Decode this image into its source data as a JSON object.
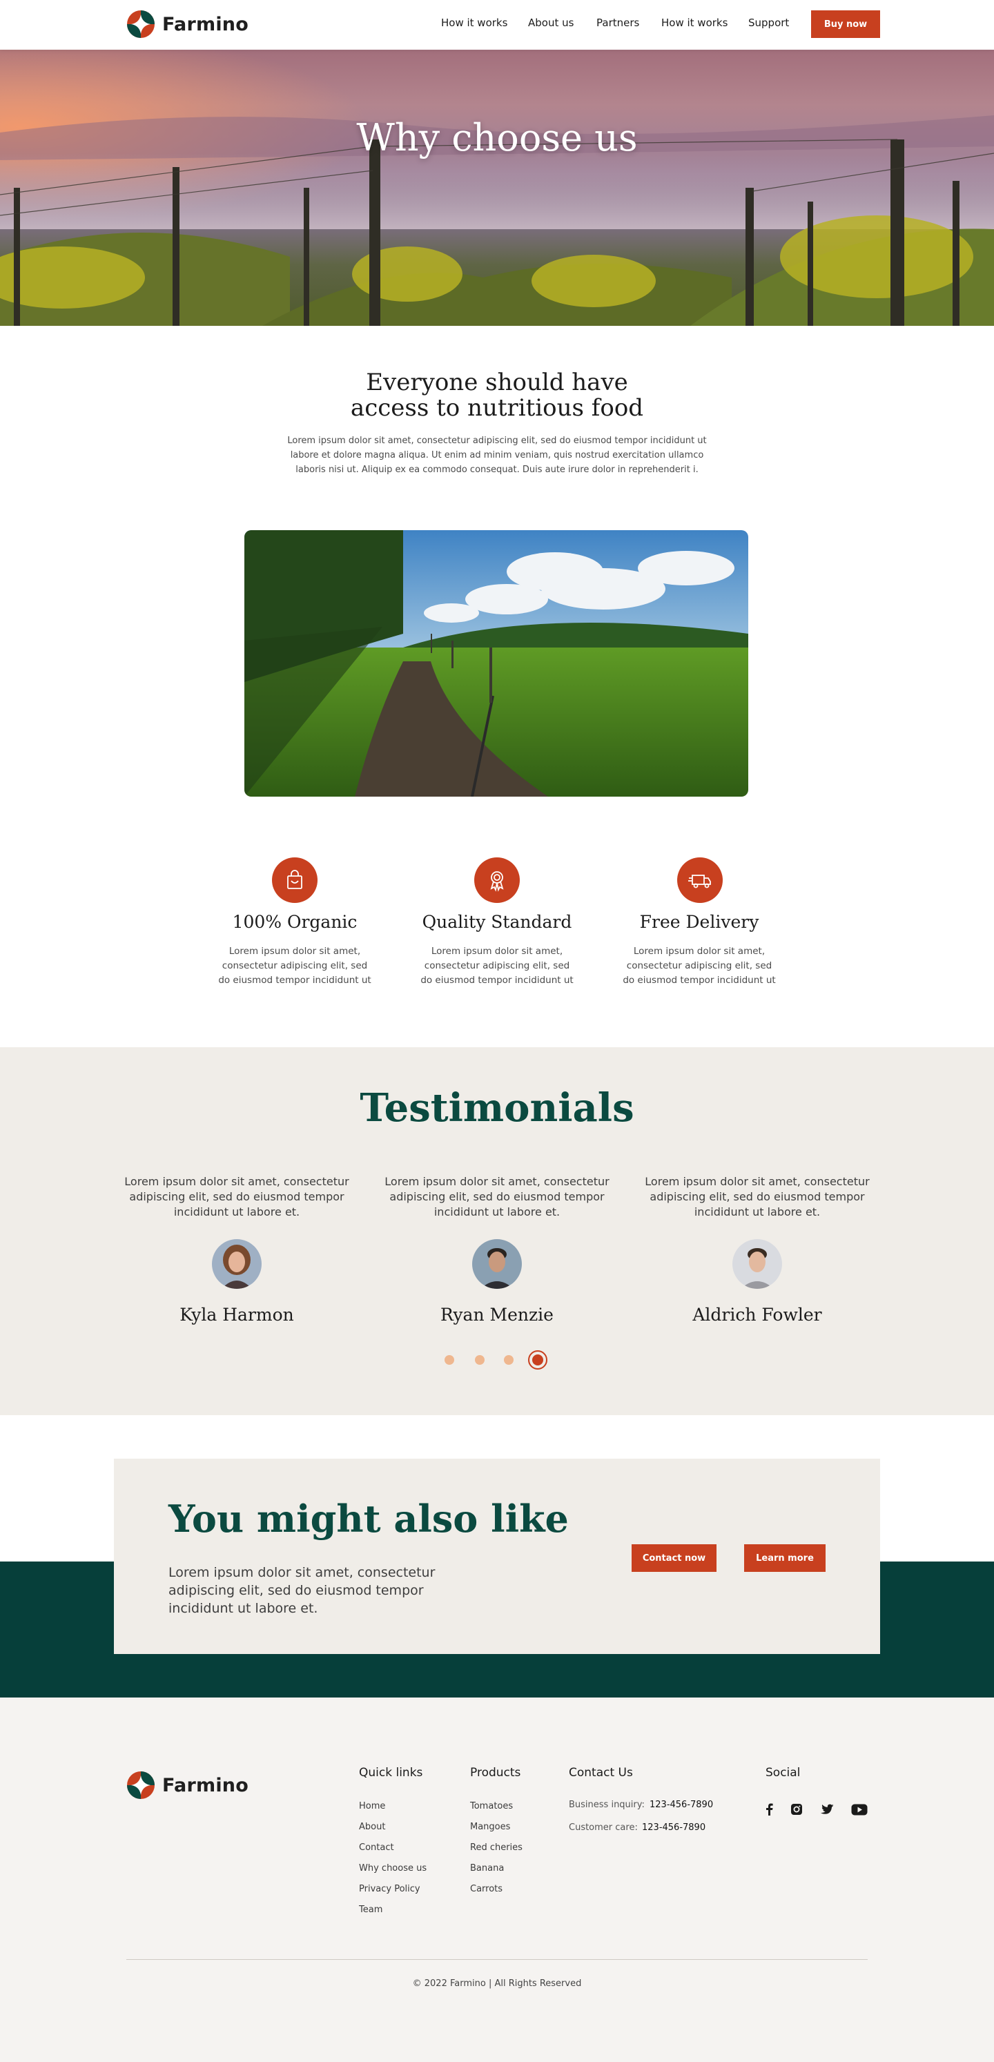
{
  "header": {
    "brand": "Farmino",
    "nav": [
      "How it works",
      "About us",
      "Partners",
      "How it works",
      "Support"
    ],
    "cta": "Buy now"
  },
  "hero": {
    "title": "Why choose us"
  },
  "intro": {
    "title_line1": "Everyone should have",
    "title_line2": "access to nutritious food",
    "text": "Lorem ipsum dolor sit amet, consectetur adipiscing elit, sed do eiusmod tempor incididunt ut labore et dolore magna aliqua. Ut enim ad minim veniam, quis nostrud exercitation ullamco laboris nisi ut. Aliquip ex ea commodo consequat. Duis aute irure dolor in reprehenderit i."
  },
  "features": [
    {
      "title": "100% Organic",
      "icon": "shopping-bag-icon",
      "text": "Lorem ipsum dolor sit amet, consectetur adipiscing elit, sed do eiusmod tempor incididunt ut"
    },
    {
      "title": "Quality Standard",
      "icon": "award-medal-icon",
      "text": "Lorem ipsum dolor sit amet, consectetur adipiscing elit, sed do eiusmod tempor incididunt ut"
    },
    {
      "title": "Free Delivery",
      "icon": "delivery-truck-icon",
      "text": "Lorem ipsum dolor sit amet, consectetur adipiscing elit, sed do eiusmod tempor incididunt ut"
    }
  ],
  "testimonials": {
    "title": "Testimonials",
    "items": [
      {
        "quote": "Lorem ipsum dolor sit amet, consectetur adipiscing elit, sed do eiusmod tempor incididunt ut labore et.",
        "name": "Kyla Harmon"
      },
      {
        "quote": "Lorem ipsum dolor sit amet, consectetur adipiscing elit, sed do eiusmod tempor incididunt ut labore et.",
        "name": "Ryan Menzie"
      },
      {
        "quote": "Lorem ipsum dolor sit amet, consectetur adipiscing elit, sed do eiusmod tempor incididunt ut labore et.",
        "name": "Aldrich Fowler"
      }
    ],
    "active_page": 4,
    "page_count": 4
  },
  "cta": {
    "title": "You might also like",
    "text": "Lorem ipsum dolor sit amet, consectetur adipiscing elit, sed do eiusmod tempor incididunt ut labore et.",
    "contact_label": "Contact now",
    "learn_label": "Learn more"
  },
  "footer": {
    "brand": "Farmino",
    "quick_links": {
      "title": "Quick links",
      "items": [
        "Home",
        "About",
        "Contact",
        "Why choose us",
        "Privacy Policy",
        "Team"
      ]
    },
    "products": {
      "title": "Products",
      "items": [
        "Tomatoes",
        "Mangoes",
        "Red cheries",
        "Banana",
        "Carrots"
      ]
    },
    "contact": {
      "title": "Contact Us",
      "business_label": "Business inquiry:",
      "business_phone": "123-456-7890",
      "care_label": "Customer care:",
      "care_phone": "123-456-7890"
    },
    "social": {
      "title": "Social",
      "icons": [
        "facebook-icon",
        "instagram-icon",
        "twitter-icon",
        "youtube-icon"
      ]
    },
    "copyright": "© 2022 Farmino | All Rights Reserved"
  },
  "colors": {
    "accent": "#c8401f",
    "dark_green": "#0b4a40",
    "band_green": "#063f3a",
    "beige": "#f0ede8"
  }
}
